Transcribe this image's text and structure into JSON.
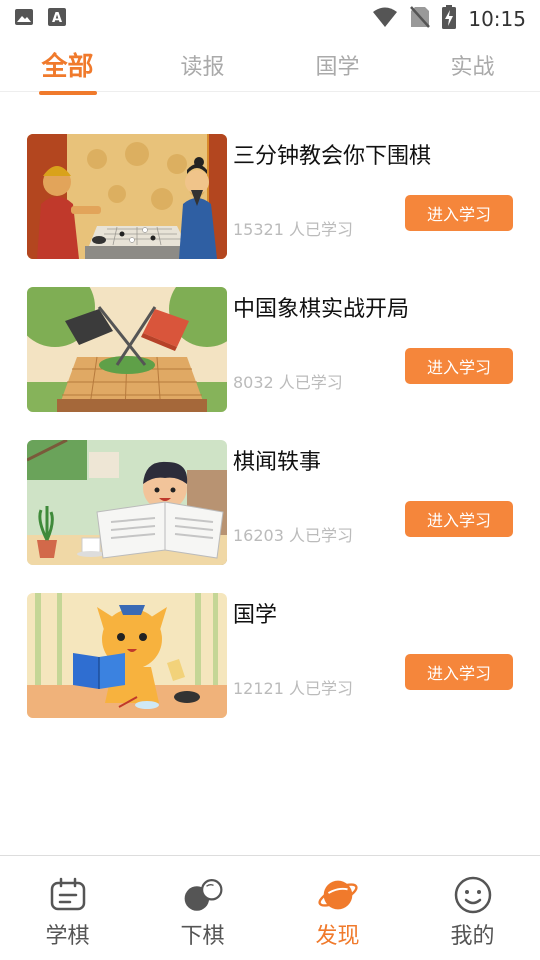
{
  "status_bar": {
    "time": "10:15",
    "icons": [
      "image-icon",
      "font-icon",
      "wifi-icon",
      "no-sim-icon",
      "battery-charging-icon"
    ]
  },
  "tabs": [
    {
      "label": "全部",
      "active": true
    },
    {
      "label": "读报",
      "active": false
    },
    {
      "label": "国学",
      "active": false
    },
    {
      "label": "实战",
      "active": false
    }
  ],
  "courses": [
    {
      "title": "三分钟教会你下围棋",
      "count": "15321 人已学习",
      "button": "进入学习",
      "thumbnail": "go-game-illustration"
    },
    {
      "title": "中国象棋实战开局",
      "count": "8032 人已学习",
      "button": "进入学习",
      "thumbnail": "chinese-chess-flags-illustration"
    },
    {
      "title": "棋闻轶事",
      "count": "16203 人已学习",
      "button": "进入学习",
      "thumbnail": "boy-reading-newspaper-illustration"
    },
    {
      "title": "国学",
      "count": "12121 人已学习",
      "button": "进入学习",
      "thumbnail": "cat-reading-book-illustration"
    }
  ],
  "bottom_nav": [
    {
      "label": "学棋",
      "icon": "calendar-board-icon",
      "active": false
    },
    {
      "label": "下棋",
      "icon": "go-stones-icon",
      "active": false
    },
    {
      "label": "发现",
      "icon": "planet-icon",
      "active": true
    },
    {
      "label": "我的",
      "icon": "smiley-face-icon",
      "active": false
    }
  ],
  "colors": {
    "accent": "#f07a2c",
    "button": "#f5863b",
    "muted_text": "#bbbbbb"
  }
}
